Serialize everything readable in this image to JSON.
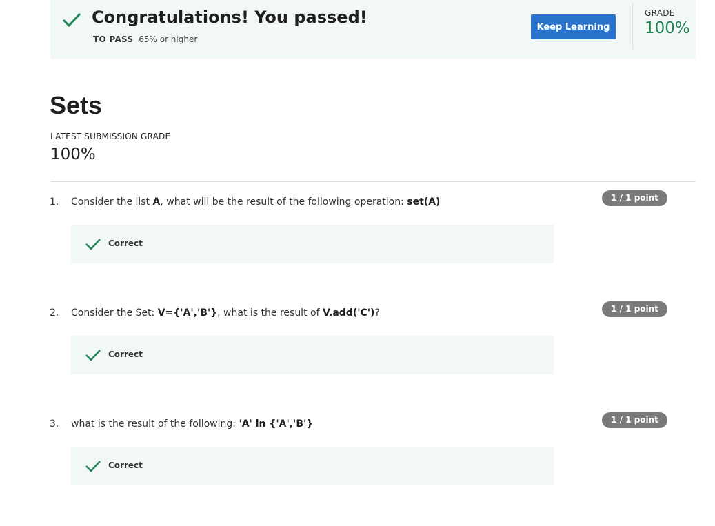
{
  "banner": {
    "title": "Congratulations! You passed!",
    "to_pass_label": "TO PASS",
    "to_pass_value": "65% or higher",
    "keep_learning_label": "Keep Learning",
    "grade_label": "GRADE",
    "grade_value": "100%",
    "icon": "checkmark-icon",
    "accent_color": "#1f8354",
    "button_color": "#2a73cc"
  },
  "quiz": {
    "title": "Sets",
    "latest_label": "LATEST SUBMISSION GRADE",
    "latest_value": "100%"
  },
  "questions": [
    {
      "number": "1.",
      "text_parts": [
        "Consider the list ",
        "A",
        ", what will be the result of the following operation: ",
        "set(A)",
        ""
      ],
      "points": "1 / 1 point",
      "feedback": "Correct"
    },
    {
      "number": "2.",
      "text_parts": [
        "Consider the Set: ",
        "V={'A','B'}",
        ", what is the result of ",
        "V.add('C')",
        "?"
      ],
      "points": "1 / 1 point",
      "feedback": "Correct"
    },
    {
      "number": "3.",
      "text_parts": [
        "what is the result of the following: ",
        "'A' in {'A','B'}",
        "",
        "",
        ""
      ],
      "points": "1 / 1 point",
      "feedback": "Correct"
    }
  ]
}
